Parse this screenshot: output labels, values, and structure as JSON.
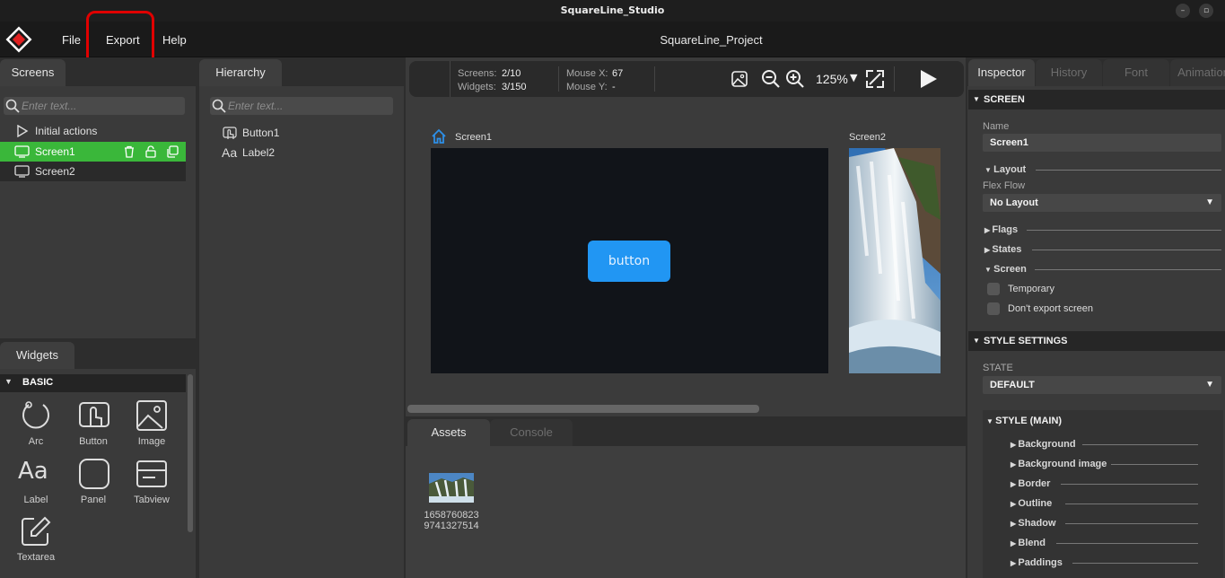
{
  "window": {
    "title": "SquareLine_Studio",
    "minimize_glyph": "–",
    "restore_glyph": "▫"
  },
  "menu": {
    "file": "File",
    "export": "Export",
    "help": "Help",
    "project": "SquareLine_Project"
  },
  "screens_panel": {
    "tab": "Screens",
    "search_placeholder": "Enter text...",
    "items": [
      "Initial actions",
      "Screen1",
      "Screen2"
    ]
  },
  "hierarchy_panel": {
    "tab": "Hierarchy",
    "search_placeholder": "Enter text...",
    "items": [
      "Button1",
      "Label2"
    ]
  },
  "widgets_panel": {
    "tab": "Widgets",
    "category": "BASIC",
    "items": [
      "Arc",
      "Button",
      "Image",
      "Label",
      "Panel",
      "Tabview",
      "Textarea"
    ]
  },
  "toolbar": {
    "screens_label": "Screens:",
    "screens_value": "2/10",
    "widgets_label": "Widgets:",
    "widgets_value": "3/150",
    "mousex_label": "Mouse X:",
    "mousex_value": "67",
    "mousey_label": "Mouse Y:",
    "mousey_value": "-",
    "zoom": "125%"
  },
  "canvas": {
    "screen1_label": "Screen1",
    "screen2_label": "Screen2",
    "button_text": "button",
    "accent": "#2196f3",
    "selected_green": "#3ab73a"
  },
  "bottom_panel": {
    "tab_assets": "Assets",
    "tab_console": "Console",
    "asset_name_line1": "1658760823",
    "asset_name_line2": "9741327514"
  },
  "inspector": {
    "tabs": [
      "Inspector",
      "History",
      "Font",
      "Animation"
    ],
    "screen_section": "SCREEN",
    "name_label": "Name",
    "name_value": "Screen1",
    "layout_label": "Layout",
    "flex_flow_label": "Flex Flow",
    "flex_flow_value": "No Layout",
    "flags_label": "Flags",
    "states_label": "States",
    "screen_label": "Screen",
    "temporary_label": "Temporary",
    "dont_export_label": "Don't export screen",
    "style_settings": "STYLE SETTINGS",
    "state_label": "STATE",
    "state_value": "DEFAULT",
    "style_main": "STYLE (MAIN)",
    "style_items": [
      "Background",
      "Background image",
      "Border",
      "Outline",
      "Shadow",
      "Blend",
      "Paddings"
    ]
  }
}
